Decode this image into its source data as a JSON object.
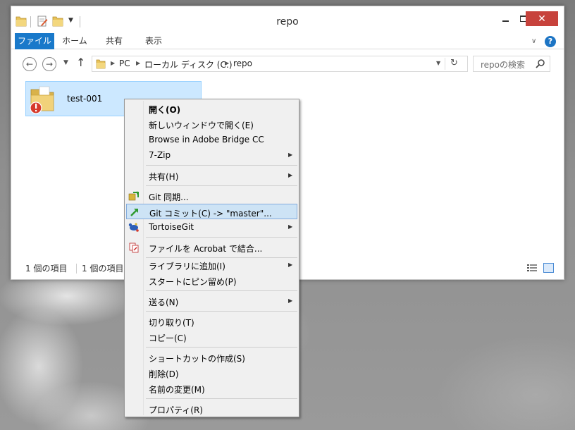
{
  "window": {
    "title": "repo"
  },
  "ribbon": {
    "tabs": [
      "ファイル",
      "ホーム",
      "共有",
      "表示"
    ],
    "help": "?"
  },
  "navigation": {
    "breadcrumbs": [
      "PC",
      "ローカル ディスク (C:)",
      "repo"
    ],
    "search_placeholder": "repoの検索"
  },
  "files": [
    {
      "name": "test-001",
      "type": "folder",
      "status": "git-conflict-overlay"
    }
  ],
  "status_bar": {
    "item_count": "1 個の項目",
    "selected": "1 個の項目を選択"
  },
  "context_menu": {
    "groups": [
      [
        {
          "label": "開く(O)",
          "bold": true,
          "submenu": false,
          "icon": ""
        },
        {
          "label": "新しいウィンドウで開く(E)",
          "bold": false,
          "submenu": false,
          "icon": ""
        },
        {
          "label": "Browse in Adobe Bridge CC",
          "bold": false,
          "submenu": false,
          "icon": ""
        },
        {
          "label": "7-Zip",
          "bold": false,
          "submenu": true,
          "icon": ""
        }
      ],
      [
        {
          "label": "共有(H)",
          "bold": false,
          "submenu": true,
          "icon": ""
        }
      ],
      [
        {
          "label": "Git 同期...",
          "bold": false,
          "submenu": false,
          "icon": "git-sync-icon"
        },
        {
          "label": "Git コミット(C) -> \"master\"...",
          "bold": false,
          "submenu": false,
          "icon": "git-commit-icon",
          "highlighted": true
        },
        {
          "label": "TortoiseGit",
          "bold": false,
          "submenu": true,
          "icon": "tortoisegit-icon"
        }
      ],
      [
        {
          "label": "ファイルを Acrobat で結合...",
          "bold": false,
          "submenu": false,
          "icon": "acrobat-combine-icon"
        }
      ],
      [
        {
          "label": "ライブラリに追加(I)",
          "bold": false,
          "submenu": true,
          "icon": ""
        },
        {
          "label": "スタートにピン留め(P)",
          "bold": false,
          "submenu": false,
          "icon": ""
        }
      ],
      [
        {
          "label": "送る(N)",
          "bold": false,
          "submenu": true,
          "icon": ""
        }
      ],
      [
        {
          "label": "切り取り(T)",
          "bold": false,
          "submenu": false,
          "icon": ""
        },
        {
          "label": "コピー(C)",
          "bold": false,
          "submenu": false,
          "icon": ""
        }
      ],
      [
        {
          "label": "ショートカットの作成(S)",
          "bold": false,
          "submenu": false,
          "icon": ""
        },
        {
          "label": "削除(D)",
          "bold": false,
          "submenu": false,
          "icon": ""
        },
        {
          "label": "名前の変更(M)",
          "bold": false,
          "submenu": false,
          "icon": ""
        }
      ],
      [
        {
          "label": "プロパティ(R)",
          "bold": false,
          "submenu": false,
          "icon": ""
        }
      ]
    ]
  },
  "colors": {
    "accent": "#1979ca",
    "selection": "#cce8ff",
    "menu_highlight": "#cde3f5",
    "close_button": "#c7423c"
  }
}
